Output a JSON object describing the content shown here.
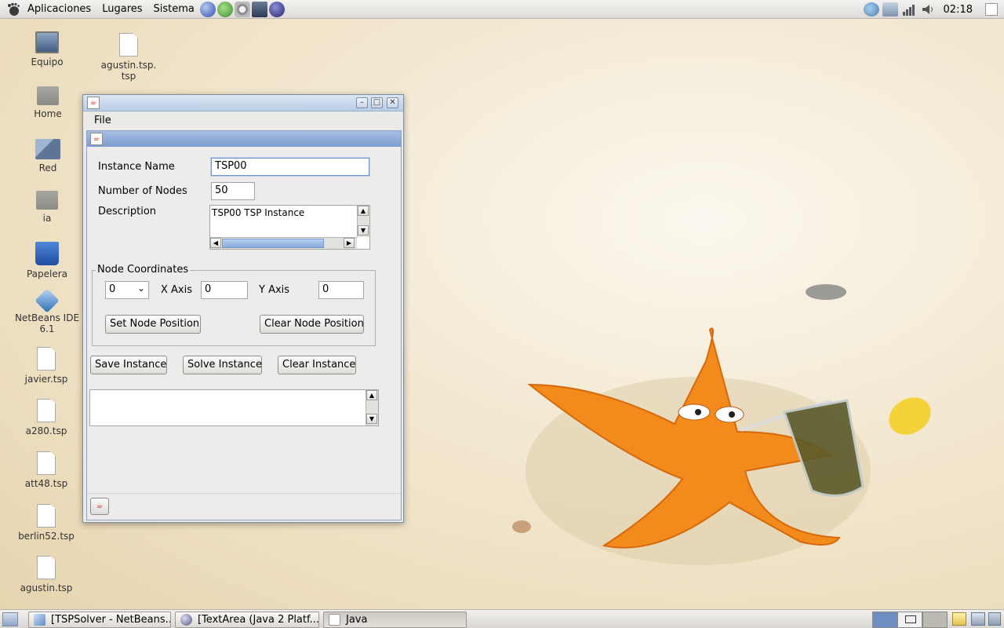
{
  "top_panel": {
    "menus": [
      "Aplicaciones",
      "Lugares",
      "Sistema"
    ],
    "clock": "02:18"
  },
  "desktop": {
    "icons": [
      {
        "label": "Equipo"
      },
      {
        "label": "agustin.tsp.\ntsp"
      },
      {
        "label": "Home"
      },
      {
        "label": "Red"
      },
      {
        "label": "ia"
      },
      {
        "label": "Papelera"
      },
      {
        "label": "NetBeans IDE 6.1"
      },
      {
        "label": "javier.tsp"
      },
      {
        "label": "a280.tsp"
      },
      {
        "label": "att48.tsp"
      },
      {
        "label": "berlin52.tsp"
      },
      {
        "label": "agustin.tsp"
      }
    ]
  },
  "window": {
    "menubar": {
      "file": "File"
    },
    "form": {
      "instance_name_label": "Instance Name",
      "instance_name_value": "TSP00",
      "num_nodes_label": "Number of Nodes",
      "num_nodes_value": "50",
      "description_label": "Description",
      "description_value": "TSP00 TSP Instance",
      "node_coords_title": "Node Coordinates",
      "node_select_value": "0",
      "x_axis_label": "X Axis",
      "x_axis_value": "0",
      "y_axis_label": "Y Axis",
      "y_axis_value": "0",
      "set_node_button": "Set Node Position",
      "clear_node_button": "Clear Node Position",
      "save_button": "Save Instance",
      "solve_button": "Solve Instance",
      "clear_button": "Clear Instance",
      "output_value": ""
    }
  },
  "taskbar": {
    "tasks": [
      {
        "label": "[TSPSolver - NetBeans..."
      },
      {
        "label": "[TextArea (Java 2 Platf..."
      },
      {
        "label": "Java"
      }
    ]
  }
}
